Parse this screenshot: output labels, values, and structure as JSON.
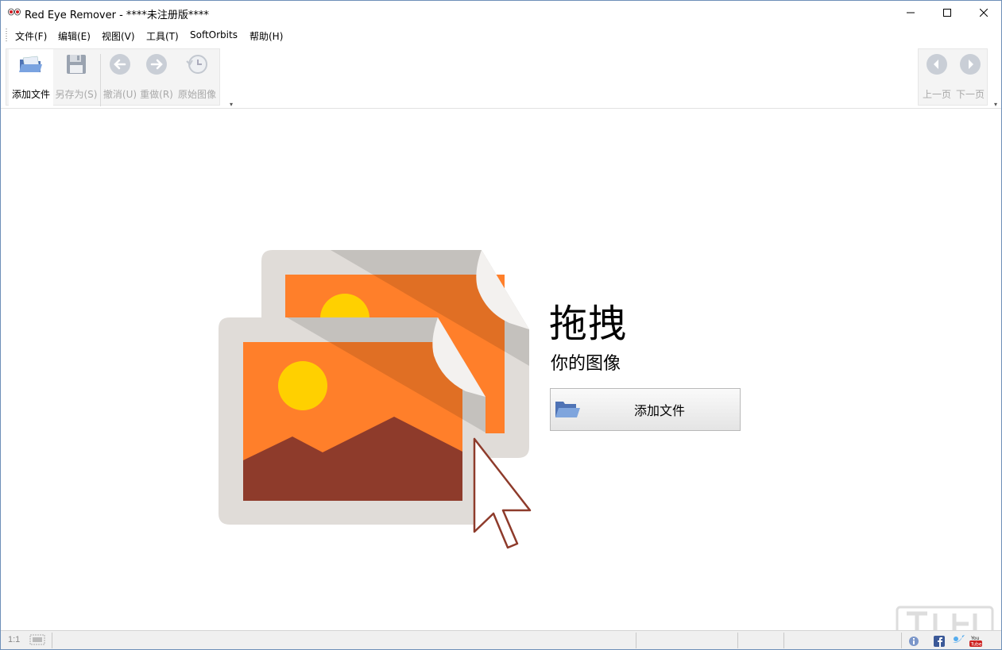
{
  "window": {
    "title": "Red Eye Remover - ****未注册版****"
  },
  "menu": {
    "items": [
      {
        "label": "文件(F)"
      },
      {
        "label": "编辑(E)"
      },
      {
        "label": "视图(V)"
      },
      {
        "label": "工具(T)"
      },
      {
        "label": "SoftOrbits"
      },
      {
        "label": "帮助(H)"
      }
    ]
  },
  "toolbar": {
    "add_file": "添加文件",
    "save_as": "另存为(S)",
    "undo": "撤消(U)",
    "redo": "重做(R)",
    "original": "原始图像",
    "prev_page": "上一页",
    "next_page": "下一页"
  },
  "main": {
    "drop_title": "拖拽",
    "drop_subtitle": "你的图像",
    "add_file_button": "添加文件"
  },
  "statusbar": {
    "zoom": "1:1"
  },
  "colors": {
    "photo_orange": "#ff7f2a",
    "sun_yellow": "#ffd000",
    "mountain_brown": "#8e3b2b",
    "frame_gray": "#e0dcd8",
    "folder_blue": "#6f8fc8"
  }
}
